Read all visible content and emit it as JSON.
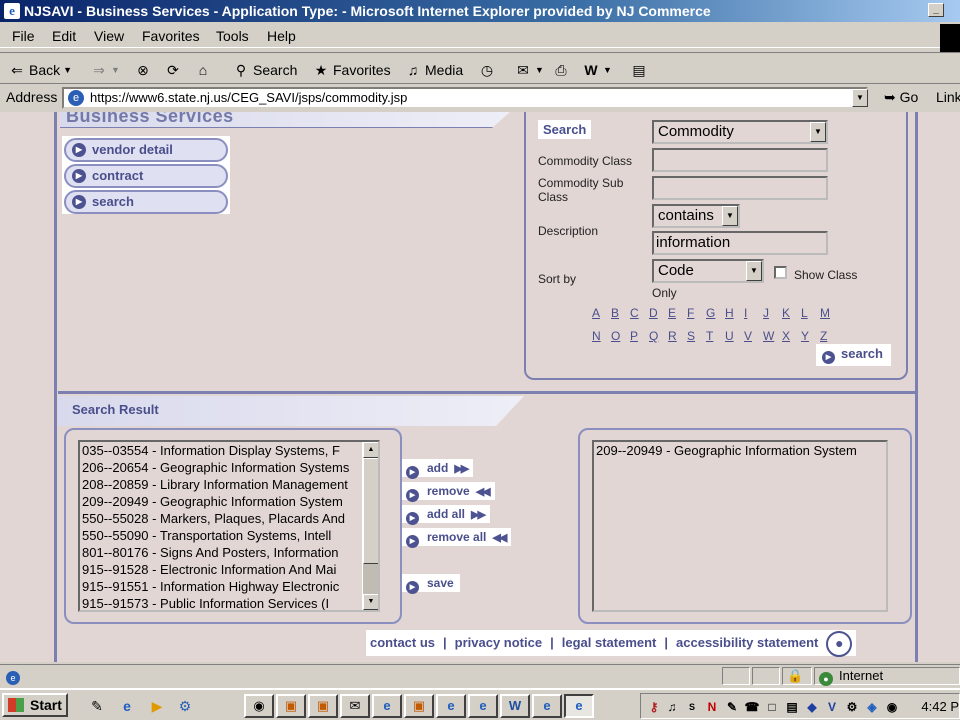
{
  "window": {
    "title": "NJSAVI - Business Services - Application Type: - Microsoft Internet Explorer provided by NJ Commerce"
  },
  "menu": [
    "File",
    "Edit",
    "View",
    "Favorites",
    "Tools",
    "Help"
  ],
  "toolbar": {
    "back": "Back",
    "search": "Search",
    "favorites": "Favorites",
    "media": "Media"
  },
  "address": {
    "label": "Address",
    "url": "https://www6.state.nj.us/CEG_SAVI/jsps/commodity.jsp",
    "go": "Go",
    "links": "Links"
  },
  "page": {
    "section_title": "Business Services",
    "nav": [
      "vendor detail",
      "contract",
      "search"
    ],
    "search_panel": {
      "title": "Search",
      "type_select": "Commodity",
      "commodity_class_label": "Commodity Class",
      "commodity_class_value": "",
      "commodity_sub_class_label": "Commodity Sub Class",
      "commodity_sub_class_value": "",
      "description_label": "Description",
      "description_match": "contains",
      "description_value": "information",
      "sort_by_label": "Sort by",
      "sort_by_value": "Code",
      "show_class_label": "Show Class",
      "only_label": "Only",
      "alphabet_row1": [
        "A",
        "B",
        "C",
        "D",
        "E",
        "F",
        "G",
        "H",
        "I",
        "J",
        "K",
        "L",
        "M"
      ],
      "alphabet_row2": [
        "N",
        "O",
        "P",
        "Q",
        "R",
        "S",
        "T",
        "U",
        "V",
        "W",
        "X",
        "Y",
        "Z"
      ],
      "search_button": "search"
    },
    "result": {
      "title": "Search Result",
      "available": [
        "035--03554 - Information Display Systems, F",
        "206--20654 - Geographic Information Systems",
        "208--20859 - Library Information Management",
        "209--20949 - Geographic Information System",
        "550--55028 - Markers, Plaques, Placards And",
        "550--55090 - Transportation Systems, Intell",
        "801--80176 - Signs And Posters, Information",
        "915--91528 - Electronic Information And Mai",
        "915--91551 - Information Highway Electronic",
        "915--91573 - Public Information Services (I"
      ],
      "selected": [
        "209--20949 - Geographic Information System"
      ],
      "actions": {
        "add": "add",
        "remove": "remove",
        "add_all": "add all",
        "remove_all": "remove all",
        "save": "save"
      }
    },
    "footer": [
      "contact us",
      "privacy notice",
      "legal statement",
      "accessibility statement"
    ]
  },
  "status": {
    "zone": "Internet"
  },
  "taskbar": {
    "start": "Start",
    "clock": "4:42 P"
  }
}
